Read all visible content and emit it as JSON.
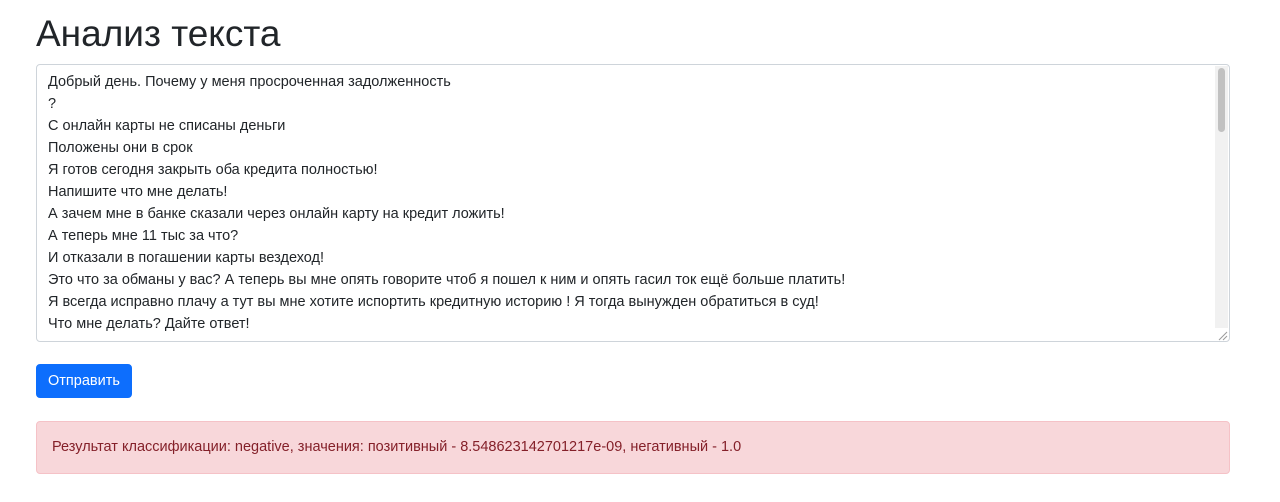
{
  "header": {
    "title": "Анализ текста"
  },
  "input": {
    "lines": [
      "Добрый день. Почему у меня просроченная задолженность",
      "?",
      "С онлайн карты не списаны деньги",
      "Положены они в срок",
      "Я готов сегодня закрыть оба кредита полностью!",
      "Напишите что мне делать!",
      "А зачем мне в банке сказали через онлайн карту на кредит ложить!",
      "А теперь мне 11 тыс за что?",
      "И отказали в погашении карты вездеход!",
      "Это что за обманы у вас? А теперь вы мне опять говорите чтоб я пошел к ним и опять гасил ток ещё больше платить!",
      "Я всегда исправно плачу а тут вы мне хотите испортить кредитную историю ! Я тогда вынужден обратиться в суд!",
      "Что мне делать? Дайте ответ!"
    ]
  },
  "actions": {
    "submit_label": "Отправить"
  },
  "result": {
    "text": "Результат классификации: negative, значения: позитивный - 8.548623142701217e-09, негативный - 1.0"
  },
  "colors": {
    "primary": "#0d6efd",
    "alert_bg": "#f8d7da",
    "alert_text": "#842029"
  }
}
